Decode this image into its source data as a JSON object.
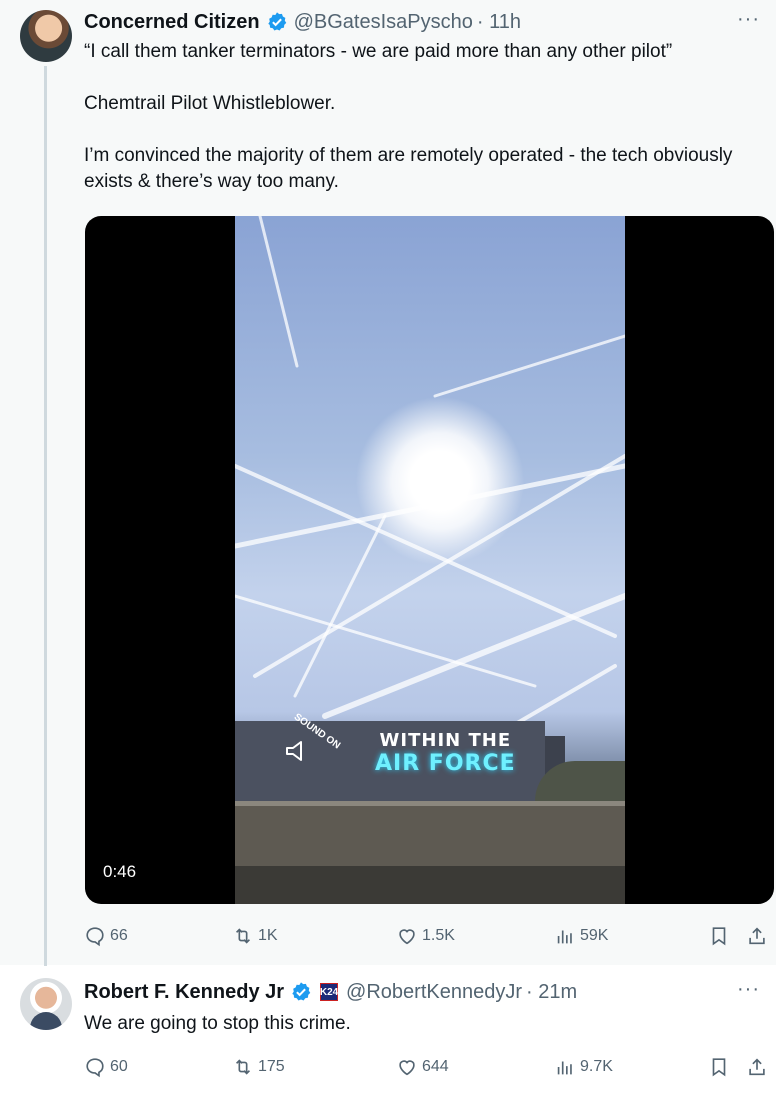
{
  "quoted_tweet": {
    "author_name": "Concerned Citizen",
    "handle": "@BGatesIsaPyscho",
    "time": "· 11h",
    "more": "···",
    "paragraphs": [
      "“I call them tanker terminators - we are paid more than any other pilot”",
      "Chemtrail Pilot Whistleblower.",
      "I’m convinced the majority of them are remotely operated - the tech obviously exists & there’s way too many."
    ],
    "video": {
      "caption_line1": "WITHIN THE",
      "caption_line2": "AIR FORCE",
      "sound_label": "SOUND ON",
      "duration": "0:46"
    },
    "actions": {
      "replies": "66",
      "reposts": "1K",
      "likes": "1.5K",
      "views": "59K"
    }
  },
  "reply_tweet": {
    "author_name": "Robert F. Kennedy Jr",
    "badge_text": "K24",
    "handle": "@RobertKennedyJr",
    "time": "· 21m",
    "more": "···",
    "text": "We are going to stop this crime.",
    "actions": {
      "replies": "60",
      "reposts": "175",
      "likes": "644",
      "views": "9.7K"
    }
  },
  "colors": {
    "verified": "#1d9bf0",
    "secondary_text": "#536471",
    "caption_accent": "#6ff0ff"
  }
}
